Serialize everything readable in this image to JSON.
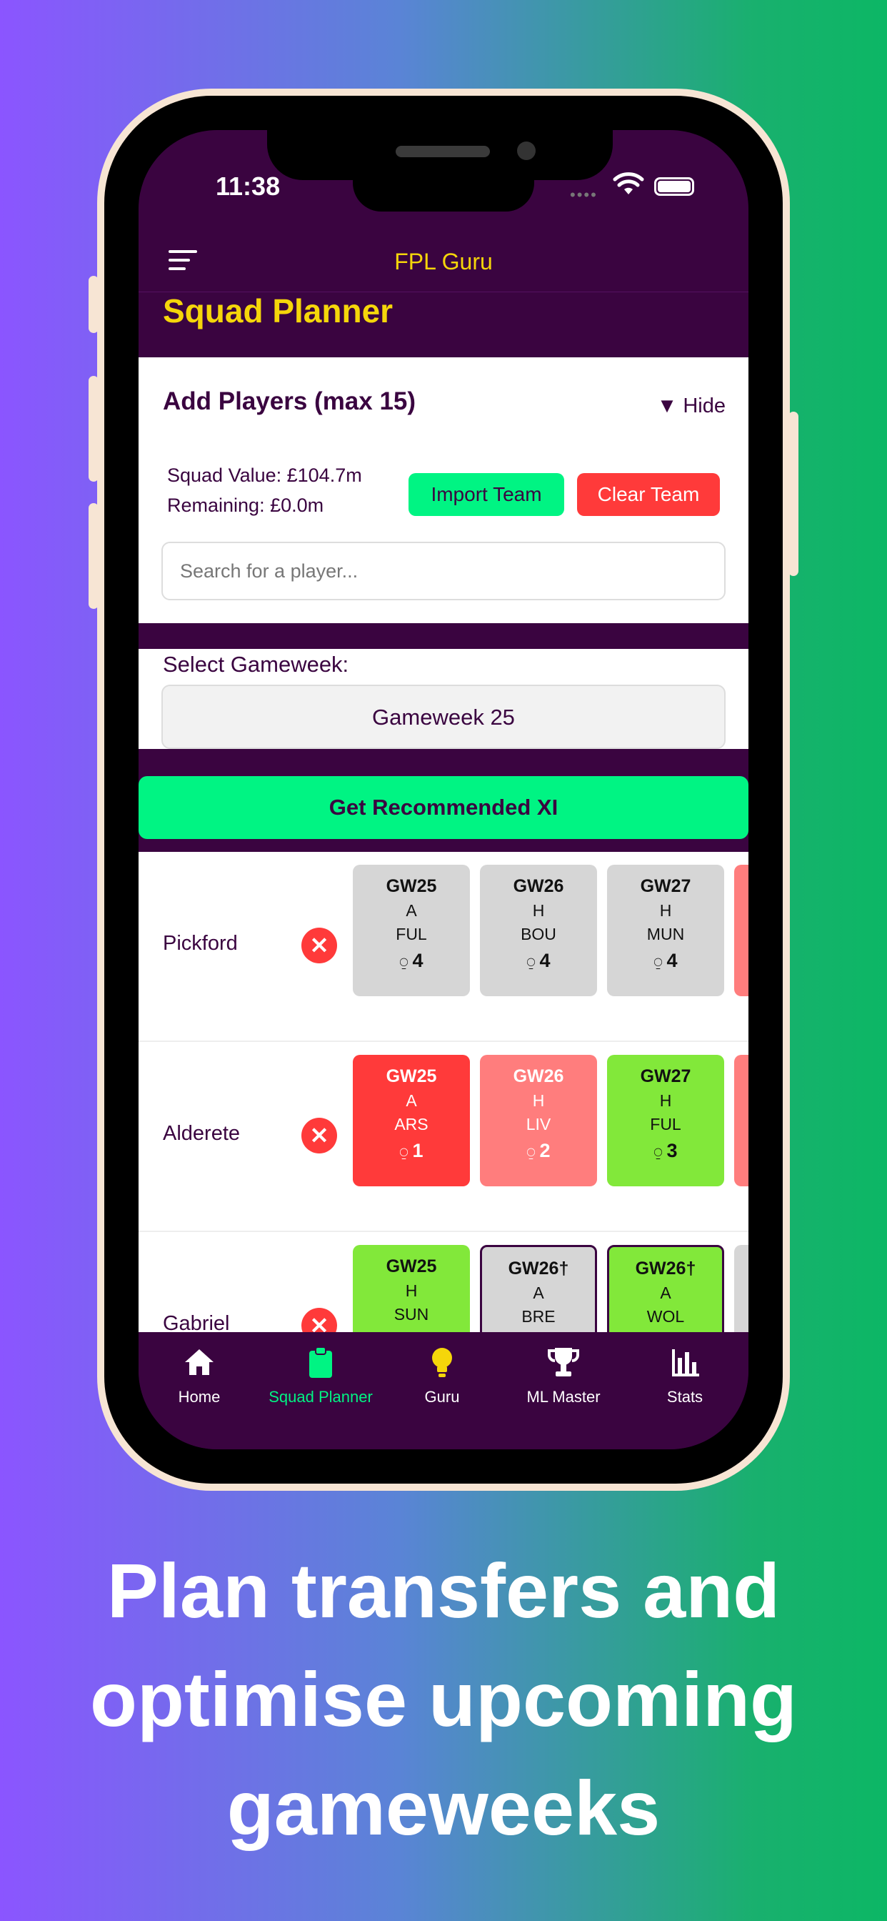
{
  "status_bar": {
    "time": "11:38"
  },
  "app_bar": {
    "title": "FPL Guru"
  },
  "page": {
    "title": "Squad Planner"
  },
  "add_players": {
    "title": "Add Players (max 15)",
    "toggle_label": "▼ Hide",
    "squad_value": "Squad Value: £104.7m",
    "remaining": "Remaining: £0.0m",
    "import_label": "Import Team",
    "clear_label": "Clear Team",
    "search_placeholder": "Search for a player..."
  },
  "gameweek": {
    "label": "Select Gameweek:",
    "selected": "Gameweek 25"
  },
  "recommend": {
    "label": "Get Recommended XI"
  },
  "players": [
    {
      "name": "Pickford",
      "fixtures": [
        {
          "gw": "GW25",
          "venue": "A",
          "opp": "FUL",
          "pts": "4"
        },
        {
          "gw": "GW26",
          "venue": "H",
          "opp": "BOU",
          "pts": "4"
        },
        {
          "gw": "GW27",
          "venue": "H",
          "opp": "MUN",
          "pts": "4"
        }
      ]
    },
    {
      "name": "Alderete",
      "fixtures": [
        {
          "gw": "GW25",
          "venue": "A",
          "opp": "ARS",
          "pts": "1"
        },
        {
          "gw": "GW26",
          "venue": "H",
          "opp": "LIV",
          "pts": "2"
        },
        {
          "gw": "GW27",
          "venue": "H",
          "opp": "FUL",
          "pts": "3"
        }
      ]
    },
    {
      "name": "Gabriel",
      "fixtures": [
        {
          "gw": "GW25",
          "venue": "H",
          "opp": "SUN"
        },
        {
          "gw": "GW26†",
          "venue": "A",
          "opp": "BRE"
        },
        {
          "gw": "GW26†",
          "venue": "A",
          "opp": "WOL"
        }
      ]
    }
  ],
  "tabs": [
    {
      "label": "Home",
      "icon": "home-icon"
    },
    {
      "label": "Squad Planner",
      "icon": "clipboard-icon"
    },
    {
      "label": "Guru",
      "icon": "lightbulb-icon"
    },
    {
      "label": "ML Master",
      "icon": "trophy-icon"
    },
    {
      "label": "Stats",
      "icon": "bar-chart-icon"
    }
  ],
  "colors": {
    "brand_purple": "#3a0440",
    "accent_yellow": "#f5d60a",
    "accent_green": "#00f483",
    "danger_red": "#ff3a3a"
  },
  "caption": {
    "line1": "Plan transfers and",
    "line2": "optimise upcoming",
    "line3": "gameweeks"
  }
}
